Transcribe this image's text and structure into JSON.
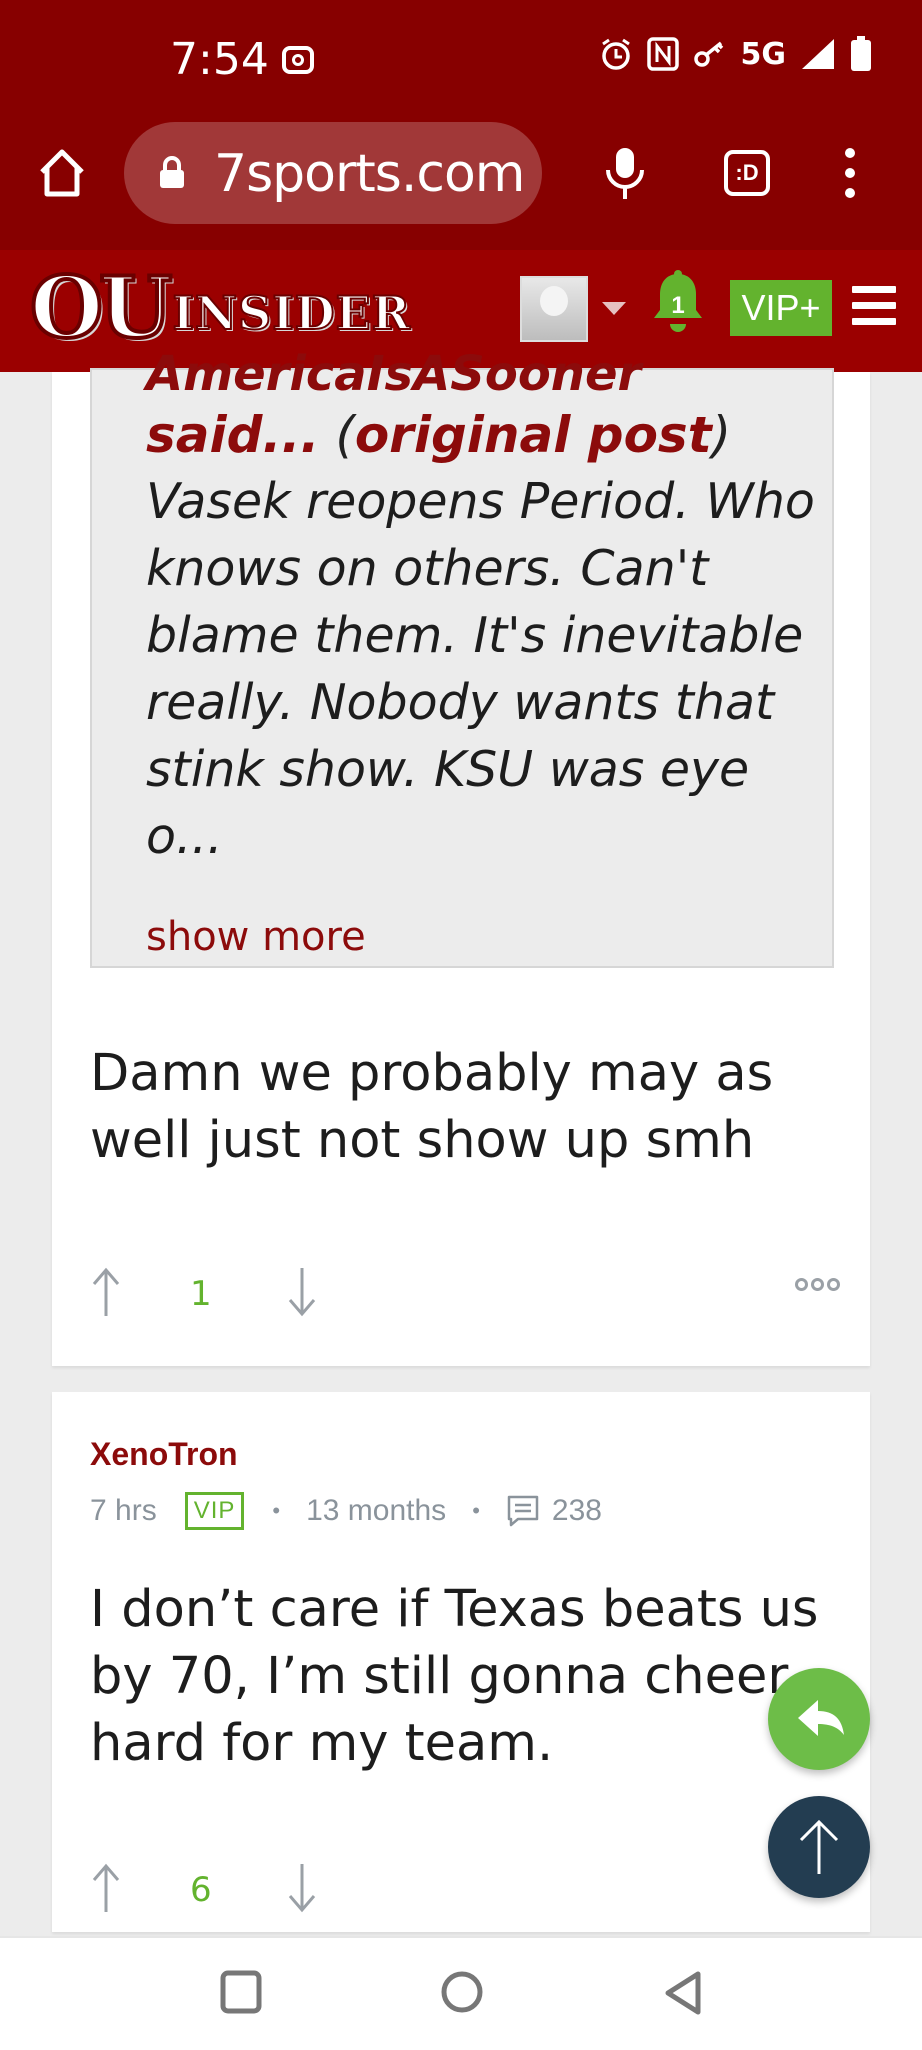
{
  "status_bar": {
    "time": "7:54",
    "network": "5G",
    "icons": [
      "screen-record-icon",
      "alarm-icon",
      "nfc-icon",
      "key-icon",
      "signal-icon",
      "battery-icon"
    ]
  },
  "browser": {
    "url": "7sports.com",
    "tab_label": ":D",
    "icons": [
      "home-icon",
      "lock-icon",
      "mic-icon",
      "tab-switcher-icon",
      "overflow-menu-icon"
    ]
  },
  "site_header": {
    "logo_ou": "OU",
    "logo_insider": "INSIDER",
    "notification_count": "1",
    "vip_label": "VIP+",
    "colors": {
      "header": "#9b0000",
      "accent_green": "#63b32e"
    }
  },
  "post1": {
    "quote": {
      "author": "AmericaIsASooner",
      "said": "said...",
      "open_paren": " (",
      "original_post_link": "original post",
      "close_paren": ")",
      "body": "Vasek reopens Period. Who knows on others. Can't blame them. It's inevitable really. Nobody wants that stink show. KSU was eye o...",
      "show_more": "show more"
    },
    "comment": "Damn we probably may as well just not show up smh",
    "votes": "1"
  },
  "post2": {
    "author": "XenoTron",
    "time_ago": "7 hrs",
    "badge": "VIP",
    "sep": "•",
    "member_for": "13 months",
    "post_count": "238",
    "comment": "I don’t care if Texas beats us by 70, I’m still gonna cheer hard for my team.",
    "votes": "6"
  },
  "floating": {
    "reply_icon": "reply-icon",
    "scroll_top_icon": "arrow-up-icon"
  },
  "nav_bar": {
    "icons": [
      "recent-apps-icon",
      "home-circle-icon",
      "back-triangle-icon"
    ]
  }
}
